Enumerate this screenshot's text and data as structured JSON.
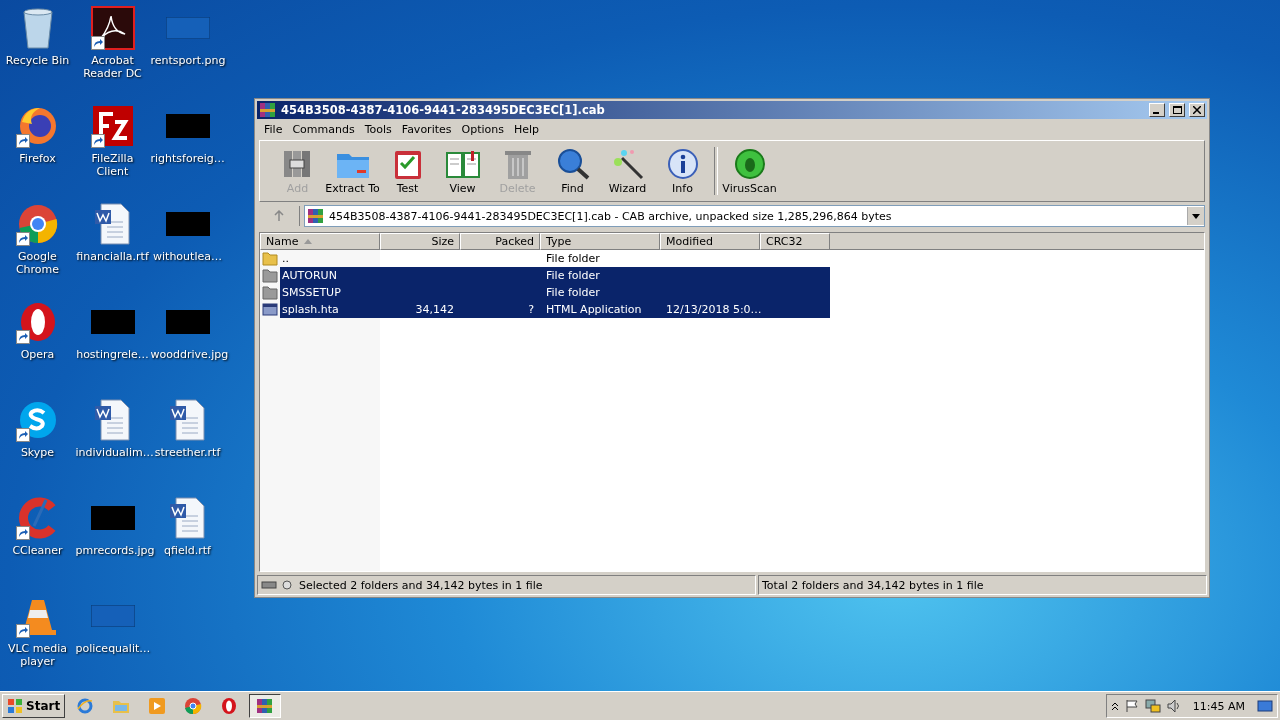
{
  "desktop": {
    "icons": [
      {
        "label": "Recycle Bin",
        "kind": "recycle",
        "shortcut": false
      },
      {
        "label": "Firefox",
        "kind": "firefox",
        "shortcut": true
      },
      {
        "label": "Google Chrome",
        "kind": "chrome",
        "shortcut": true
      },
      {
        "label": "Opera",
        "kind": "opera",
        "shortcut": true
      },
      {
        "label": "Skype",
        "kind": "skype",
        "shortcut": true
      },
      {
        "label": "CCleaner",
        "kind": "ccleaner",
        "shortcut": true
      },
      {
        "label": "VLC media player",
        "kind": "vlc",
        "shortcut": true
      },
      {
        "label": "Acrobat Reader DC",
        "kind": "acrobat",
        "shortcut": true
      },
      {
        "label": "FileZilla Client",
        "kind": "filezilla",
        "shortcut": true
      },
      {
        "label": "financialla.rtf",
        "kind": "word",
        "shortcut": false
      },
      {
        "label": "hostingrele…",
        "kind": "black",
        "shortcut": false
      },
      {
        "label": "individualim…",
        "kind": "word",
        "shortcut": false
      },
      {
        "label": "pmrecords.jpg",
        "kind": "black",
        "shortcut": false
      },
      {
        "label": "policequalit…",
        "kind": "blank",
        "shortcut": false
      },
      {
        "label": "rentsport.png",
        "kind": "blank",
        "shortcut": false
      },
      {
        "label": "rightsforeig…",
        "kind": "black",
        "shortcut": false
      },
      {
        "label": "withoutlea…",
        "kind": "black",
        "shortcut": false
      },
      {
        "label": "wooddrive.jpg",
        "kind": "black",
        "shortcut": false
      },
      {
        "label": "streether.rtf",
        "kind": "word",
        "shortcut": false
      },
      {
        "label": "qfield.rtf",
        "kind": "word",
        "shortcut": false
      }
    ]
  },
  "window": {
    "title": "454B3508-4387-4106-9441-283495DEC3EC[1].cab",
    "menu": [
      "File",
      "Commands",
      "Tools",
      "Favorites",
      "Options",
      "Help"
    ],
    "toolbar": [
      [
        {
          "label": "Add",
          "kind": "add",
          "disabled": true
        },
        {
          "label": "Extract To",
          "kind": "extract",
          "disabled": false
        },
        {
          "label": "Test",
          "kind": "test",
          "disabled": false
        },
        {
          "label": "View",
          "kind": "view",
          "disabled": false
        },
        {
          "label": "Delete",
          "kind": "delete",
          "disabled": true
        },
        {
          "label": "Find",
          "kind": "find",
          "disabled": false
        },
        {
          "label": "Wizard",
          "kind": "wizard",
          "disabled": false
        },
        {
          "label": "Info",
          "kind": "info",
          "disabled": false
        }
      ],
      [
        {
          "label": "VirusScan",
          "kind": "virus",
          "disabled": false
        }
      ]
    ],
    "address": "454B3508-4387-4106-9441-283495DEC3EC[1].cab - CAB archive, unpacked size 1,285,296,864 bytes",
    "columns": [
      {
        "label": "Name",
        "sorted": true
      },
      {
        "label": "Size",
        "sorted": false
      },
      {
        "label": "Packed",
        "sorted": false
      },
      {
        "label": "Type",
        "sorted": false
      },
      {
        "label": "Modified",
        "sorted": false
      },
      {
        "label": "CRC32",
        "sorted": false
      }
    ],
    "rows": [
      {
        "kind": "folder",
        "name": "..",
        "type": "File folder",
        "selected": false
      },
      {
        "kind": "grayfolder",
        "name": "AUTORUN",
        "type": "File folder",
        "selected": true
      },
      {
        "kind": "grayfolder",
        "name": "SMSSETUP",
        "type": "File folder",
        "selected": true
      },
      {
        "kind": "hta",
        "name": "splash.hta",
        "size": "34,142",
        "packed": "?",
        "type": "HTML Application",
        "modified": "12/13/2018 5:0…",
        "selected": true
      }
    ],
    "status_left": "Selected 2 folders and 34,142 bytes in 1 file",
    "status_right": "Total 2 folders and 34,142 bytes in 1 file"
  },
  "taskbar": {
    "start": "Start",
    "apps": [
      {
        "kind": "ie",
        "selected": false
      },
      {
        "kind": "explorer",
        "selected": false
      },
      {
        "kind": "media",
        "selected": false
      },
      {
        "kind": "chrome",
        "selected": false
      },
      {
        "kind": "opera",
        "selected": false
      },
      {
        "kind": "winrar",
        "selected": true
      }
    ],
    "clock": "11:45 AM"
  }
}
